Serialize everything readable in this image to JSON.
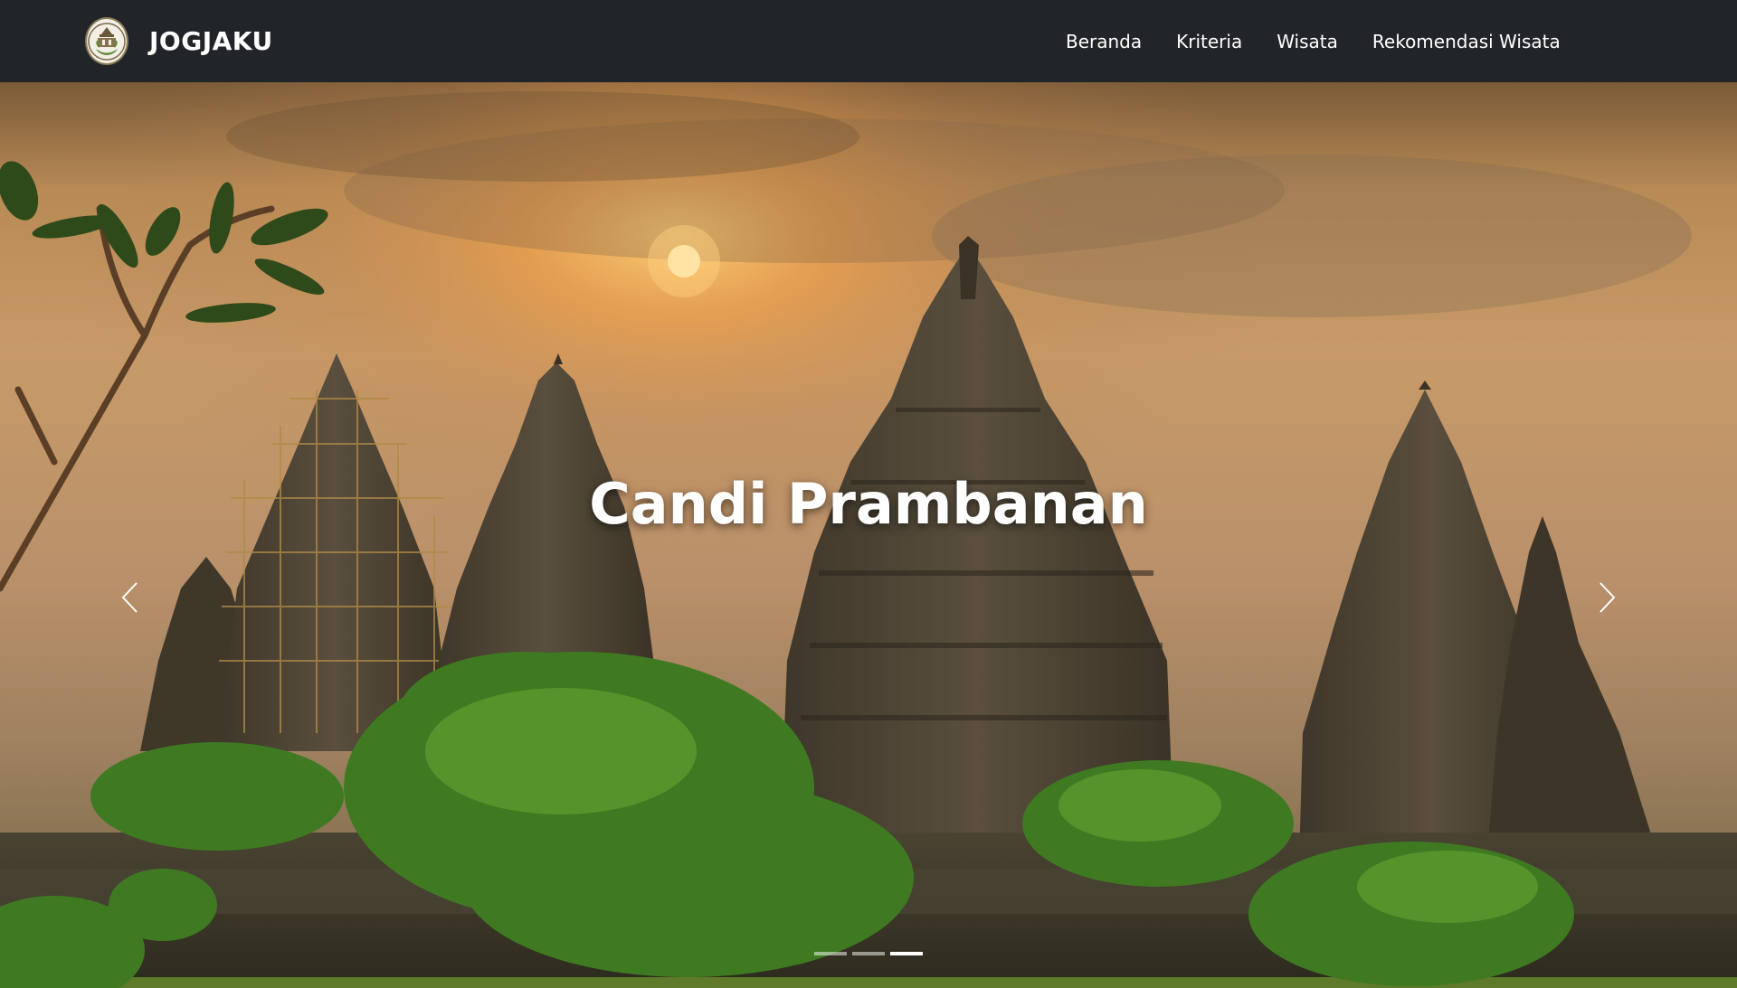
{
  "brand": {
    "name": "JOGJAKU",
    "logo_icon": "jogjaku-logo-icon"
  },
  "nav": {
    "items": [
      {
        "label": "Beranda"
      },
      {
        "label": "Kriteria"
      },
      {
        "label": "Wisata"
      },
      {
        "label": "Rekomendasi Wisata"
      }
    ]
  },
  "carousel": {
    "caption": "Candi Prambanan",
    "prev_icon": "chevron-left-icon",
    "next_icon": "chevron-right-icon",
    "slide_count": 3,
    "active_index": 2
  },
  "colors": {
    "navbar": "#212529",
    "text": "#ffffff"
  }
}
